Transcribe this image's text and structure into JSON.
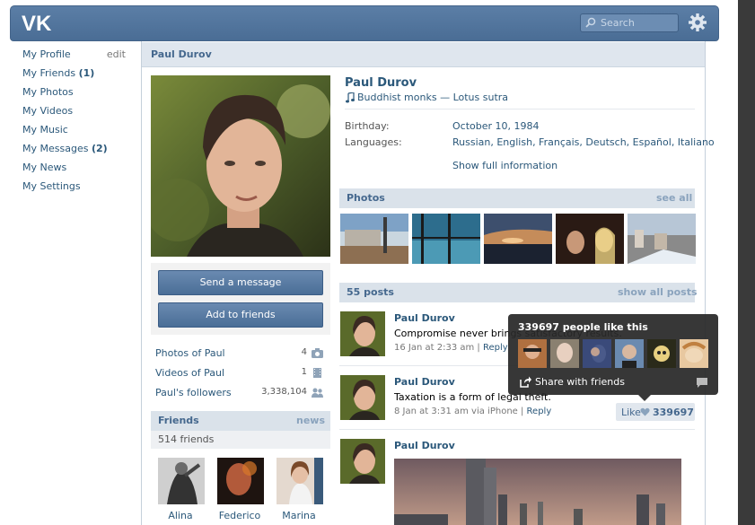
{
  "header": {
    "search_placeholder": "Search"
  },
  "nav": {
    "edit_label": "edit",
    "items": [
      {
        "label": "My Profile",
        "count": ""
      },
      {
        "label": "My Friends",
        "count": "1"
      },
      {
        "label": "My Photos",
        "count": ""
      },
      {
        "label": "My Videos",
        "count": ""
      },
      {
        "label": "My Music",
        "count": ""
      },
      {
        "label": "My Messages",
        "count": "2"
      },
      {
        "label": "My News",
        "count": ""
      },
      {
        "label": "My Settings",
        "count": ""
      }
    ]
  },
  "page_title": "Paul Durov",
  "profile": {
    "name": "Paul Durov",
    "status_music": "Buddhist monks — Lotus sutra",
    "birthday_label": "Birthday:",
    "birthday_value": "October 10, 1984",
    "languages_label": "Languages:",
    "languages_value": "Russian, English, Français, Deutsch, Español, Italiano",
    "show_full": "Show full information"
  },
  "actions": {
    "send_message": "Send a message",
    "add_friend": "Add to friends"
  },
  "stats": [
    {
      "label": "Photos of Paul",
      "count": "4",
      "icon": "camera-icon"
    },
    {
      "label": "Videos of Paul",
      "count": "1",
      "icon": "film-icon"
    },
    {
      "label": "Paul's followers",
      "count": "3,338,104",
      "icon": "people-icon"
    }
  ],
  "friends": {
    "title": "Friends",
    "news_link": "news",
    "count_text": "514 friends",
    "items": [
      {
        "name": "Alina"
      },
      {
        "name": "Federico"
      },
      {
        "name": "Marina"
      }
    ]
  },
  "photos_section": {
    "title": "Photos",
    "link": "see all"
  },
  "posts_section": {
    "title": "55 posts",
    "link": "show all posts"
  },
  "posts": [
    {
      "author": "Paul Durov",
      "text": "Compromise never brings satisfactory results.",
      "date": "16 Jan at 2:33 am",
      "reply": "Reply"
    },
    {
      "author": "Paul Durov",
      "text": "Taxation is a form of legal theft.",
      "date": "8 Jan at 3:31 am via iPhone",
      "reply": "Reply"
    },
    {
      "author": "Paul Durov",
      "text": "",
      "date": "",
      "reply": ""
    }
  ],
  "like": {
    "label": "Like",
    "count": "339697"
  },
  "popup": {
    "title": "339697 people like this",
    "share": "Share with friends"
  },
  "colors": {
    "header_blue": "#4a6d95",
    "link": "#2b587a",
    "section_bg": "#dae2ea"
  }
}
